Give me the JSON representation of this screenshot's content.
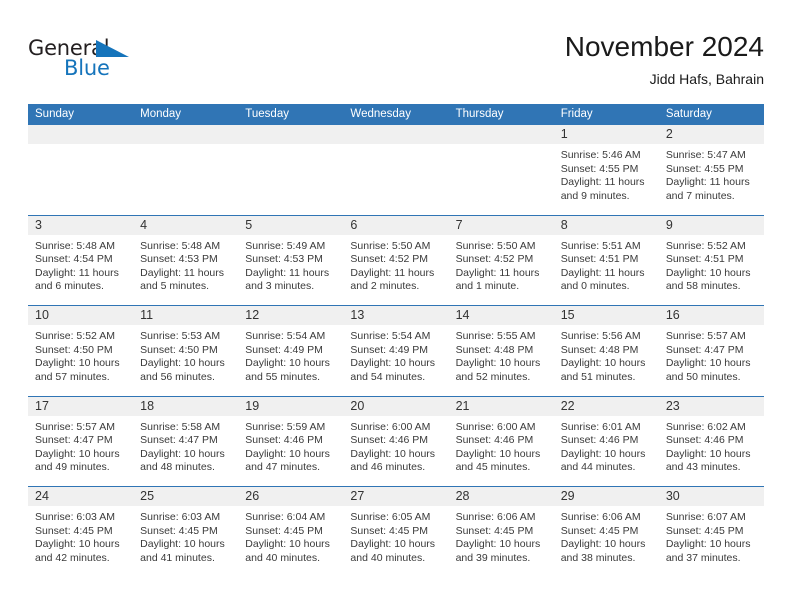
{
  "brand": {
    "name_part1": "General",
    "name_part2": "Blue"
  },
  "header": {
    "month_title": "November 2024",
    "location": "Jidd Hafs, Bahrain"
  },
  "colors": {
    "header_blue": "#3075b5",
    "brand_blue": "#1574bb",
    "daynum_band": "#f0f0f0",
    "text": "#3a3a3a"
  },
  "calendar": {
    "day_headers": [
      "Sunday",
      "Monday",
      "Tuesday",
      "Wednesday",
      "Thursday",
      "Friday",
      "Saturday"
    ],
    "weeks": [
      [
        {
          "day": "",
          "sunrise": "",
          "sunset": "",
          "daylight": "",
          "empty": true
        },
        {
          "day": "",
          "sunrise": "",
          "sunset": "",
          "daylight": "",
          "empty": true
        },
        {
          "day": "",
          "sunrise": "",
          "sunset": "",
          "daylight": "",
          "empty": true
        },
        {
          "day": "",
          "sunrise": "",
          "sunset": "",
          "daylight": "",
          "empty": true
        },
        {
          "day": "",
          "sunrise": "",
          "sunset": "",
          "daylight": "",
          "empty": true
        },
        {
          "day": "1",
          "sunrise": "Sunrise: 5:46 AM",
          "sunset": "Sunset: 4:55 PM",
          "daylight": "Daylight: 11 hours and 9 minutes."
        },
        {
          "day": "2",
          "sunrise": "Sunrise: 5:47 AM",
          "sunset": "Sunset: 4:55 PM",
          "daylight": "Daylight: 11 hours and 7 minutes."
        }
      ],
      [
        {
          "day": "3",
          "sunrise": "Sunrise: 5:48 AM",
          "sunset": "Sunset: 4:54 PM",
          "daylight": "Daylight: 11 hours and 6 minutes."
        },
        {
          "day": "4",
          "sunrise": "Sunrise: 5:48 AM",
          "sunset": "Sunset: 4:53 PM",
          "daylight": "Daylight: 11 hours and 5 minutes."
        },
        {
          "day": "5",
          "sunrise": "Sunrise: 5:49 AM",
          "sunset": "Sunset: 4:53 PM",
          "daylight": "Daylight: 11 hours and 3 minutes."
        },
        {
          "day": "6",
          "sunrise": "Sunrise: 5:50 AM",
          "sunset": "Sunset: 4:52 PM",
          "daylight": "Daylight: 11 hours and 2 minutes."
        },
        {
          "day": "7",
          "sunrise": "Sunrise: 5:50 AM",
          "sunset": "Sunset: 4:52 PM",
          "daylight": "Daylight: 11 hours and 1 minute."
        },
        {
          "day": "8",
          "sunrise": "Sunrise: 5:51 AM",
          "sunset": "Sunset: 4:51 PM",
          "daylight": "Daylight: 11 hours and 0 minutes."
        },
        {
          "day": "9",
          "sunrise": "Sunrise: 5:52 AM",
          "sunset": "Sunset: 4:51 PM",
          "daylight": "Daylight: 10 hours and 58 minutes."
        }
      ],
      [
        {
          "day": "10",
          "sunrise": "Sunrise: 5:52 AM",
          "sunset": "Sunset: 4:50 PM",
          "daylight": "Daylight: 10 hours and 57 minutes."
        },
        {
          "day": "11",
          "sunrise": "Sunrise: 5:53 AM",
          "sunset": "Sunset: 4:50 PM",
          "daylight": "Daylight: 10 hours and 56 minutes."
        },
        {
          "day": "12",
          "sunrise": "Sunrise: 5:54 AM",
          "sunset": "Sunset: 4:49 PM",
          "daylight": "Daylight: 10 hours and 55 minutes."
        },
        {
          "day": "13",
          "sunrise": "Sunrise: 5:54 AM",
          "sunset": "Sunset: 4:49 PM",
          "daylight": "Daylight: 10 hours and 54 minutes."
        },
        {
          "day": "14",
          "sunrise": "Sunrise: 5:55 AM",
          "sunset": "Sunset: 4:48 PM",
          "daylight": "Daylight: 10 hours and 52 minutes."
        },
        {
          "day": "15",
          "sunrise": "Sunrise: 5:56 AM",
          "sunset": "Sunset: 4:48 PM",
          "daylight": "Daylight: 10 hours and 51 minutes."
        },
        {
          "day": "16",
          "sunrise": "Sunrise: 5:57 AM",
          "sunset": "Sunset: 4:47 PM",
          "daylight": "Daylight: 10 hours and 50 minutes."
        }
      ],
      [
        {
          "day": "17",
          "sunrise": "Sunrise: 5:57 AM",
          "sunset": "Sunset: 4:47 PM",
          "daylight": "Daylight: 10 hours and 49 minutes."
        },
        {
          "day": "18",
          "sunrise": "Sunrise: 5:58 AM",
          "sunset": "Sunset: 4:47 PM",
          "daylight": "Daylight: 10 hours and 48 minutes."
        },
        {
          "day": "19",
          "sunrise": "Sunrise: 5:59 AM",
          "sunset": "Sunset: 4:46 PM",
          "daylight": "Daylight: 10 hours and 47 minutes."
        },
        {
          "day": "20",
          "sunrise": "Sunrise: 6:00 AM",
          "sunset": "Sunset: 4:46 PM",
          "daylight": "Daylight: 10 hours and 46 minutes."
        },
        {
          "day": "21",
          "sunrise": "Sunrise: 6:00 AM",
          "sunset": "Sunset: 4:46 PM",
          "daylight": "Daylight: 10 hours and 45 minutes."
        },
        {
          "day": "22",
          "sunrise": "Sunrise: 6:01 AM",
          "sunset": "Sunset: 4:46 PM",
          "daylight": "Daylight: 10 hours and 44 minutes."
        },
        {
          "day": "23",
          "sunrise": "Sunrise: 6:02 AM",
          "sunset": "Sunset: 4:46 PM",
          "daylight": "Daylight: 10 hours and 43 minutes."
        }
      ],
      [
        {
          "day": "24",
          "sunrise": "Sunrise: 6:03 AM",
          "sunset": "Sunset: 4:45 PM",
          "daylight": "Daylight: 10 hours and 42 minutes."
        },
        {
          "day": "25",
          "sunrise": "Sunrise: 6:03 AM",
          "sunset": "Sunset: 4:45 PM",
          "daylight": "Daylight: 10 hours and 41 minutes."
        },
        {
          "day": "26",
          "sunrise": "Sunrise: 6:04 AM",
          "sunset": "Sunset: 4:45 PM",
          "daylight": "Daylight: 10 hours and 40 minutes."
        },
        {
          "day": "27",
          "sunrise": "Sunrise: 6:05 AM",
          "sunset": "Sunset: 4:45 PM",
          "daylight": "Daylight: 10 hours and 40 minutes."
        },
        {
          "day": "28",
          "sunrise": "Sunrise: 6:06 AM",
          "sunset": "Sunset: 4:45 PM",
          "daylight": "Daylight: 10 hours and 39 minutes."
        },
        {
          "day": "29",
          "sunrise": "Sunrise: 6:06 AM",
          "sunset": "Sunset: 4:45 PM",
          "daylight": "Daylight: 10 hours and 38 minutes."
        },
        {
          "day": "30",
          "sunrise": "Sunrise: 6:07 AM",
          "sunset": "Sunset: 4:45 PM",
          "daylight": "Daylight: 10 hours and 37 minutes."
        }
      ]
    ]
  }
}
